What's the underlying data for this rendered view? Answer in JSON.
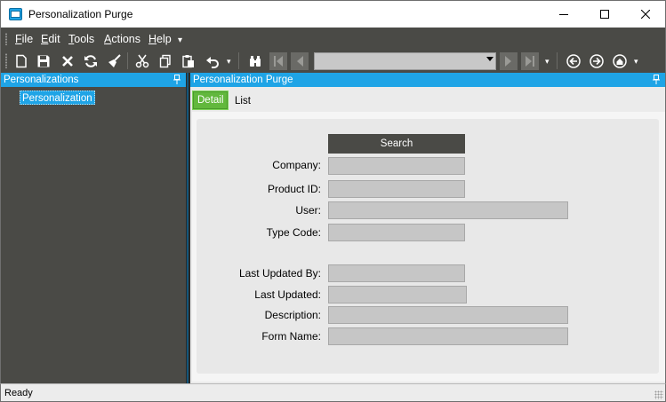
{
  "window": {
    "title": "Personalization Purge",
    "icon": "app-window-icon"
  },
  "menu": {
    "items": [
      {
        "label": "File",
        "mnemonic": "F",
        "rest": "ile"
      },
      {
        "label": "Edit",
        "mnemonic": "E",
        "rest": "dit"
      },
      {
        "label": "Tools",
        "mnemonic": "T",
        "rest": "ools"
      },
      {
        "label": "Actions",
        "mnemonic": "A",
        "rest": "ctions"
      },
      {
        "label": "Help",
        "mnemonic": "H",
        "rest": "elp"
      }
    ]
  },
  "toolbar": {
    "buttons": [
      "new-icon",
      "save-icon",
      "delete-icon",
      "refresh-icon",
      "clear-icon",
      "cut-icon",
      "copy-icon",
      "paste-icon",
      "undo-icon",
      "binoculars-icon",
      "first-record-icon",
      "previous-record-icon",
      "next-record-icon",
      "last-record-icon",
      "back-icon",
      "forward-icon",
      "home-icon"
    ],
    "record_combo_value": ""
  },
  "left_panel": {
    "title": "Personalizations",
    "tree": [
      {
        "label": "Personalization",
        "selected": true
      }
    ]
  },
  "right_panel": {
    "title": "Personalization Purge",
    "tabs": [
      {
        "label": "Detail",
        "active": true
      },
      {
        "label": "List",
        "active": false
      }
    ],
    "search_label": "Search",
    "fields": [
      {
        "label": "Company:",
        "value": ""
      },
      {
        "label": "Product ID:",
        "value": ""
      },
      {
        "label": "User:",
        "value": ""
      },
      {
        "label": "Type Code:",
        "value": ""
      },
      {
        "label": "Last Updated By:",
        "value": ""
      },
      {
        "label": "Last Updated:",
        "value": ""
      },
      {
        "label": "Description:",
        "value": ""
      },
      {
        "label": "Form Name:",
        "value": ""
      }
    ]
  },
  "status": {
    "text": "Ready"
  },
  "colors": {
    "accent": "#1fa4e6",
    "active_tab": "#62b83d",
    "dark_bg": "#4a4a46",
    "field_bg": "#c6c6c6"
  }
}
